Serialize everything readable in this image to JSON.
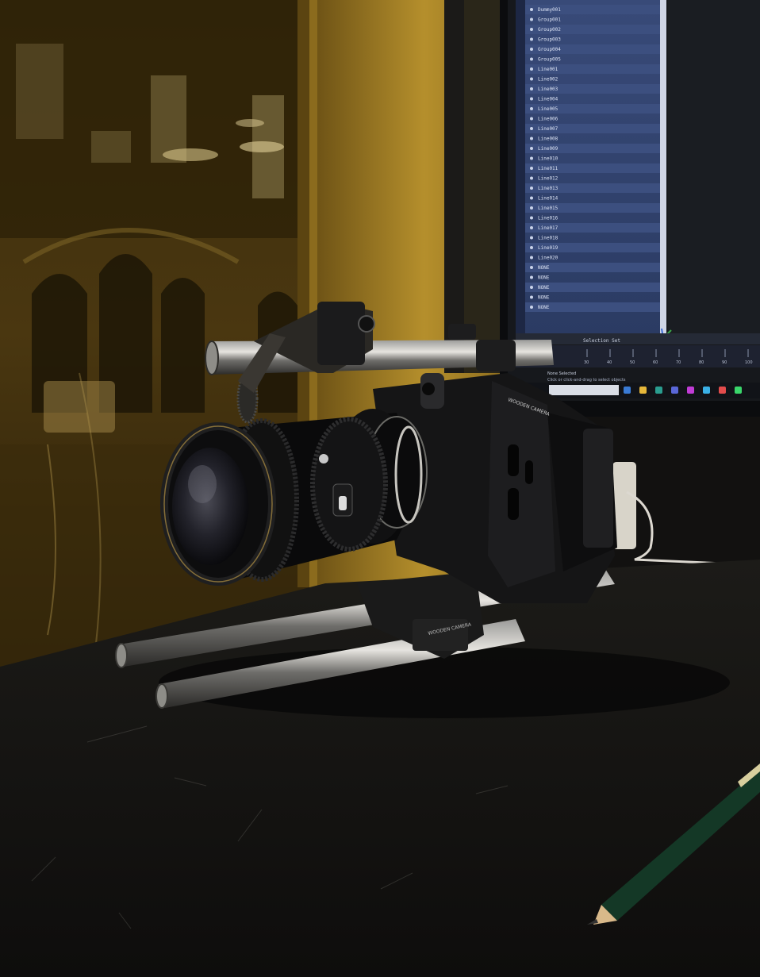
{
  "photo": {
    "description_hidden": false
  },
  "monitor": {
    "outliner_items": [
      "Dummy001",
      "Group001",
      "Group002",
      "Group003",
      "Group004",
      "Group005",
      "Line001",
      "Line002",
      "Line003",
      "Line004",
      "Line005",
      "Line006",
      "Line007",
      "Line008",
      "Line009",
      "Line010",
      "Line011",
      "Line012",
      "Line013",
      "Line014",
      "Line015",
      "Line016",
      "Line017",
      "Line018",
      "Line019",
      "Line020",
      "NONE",
      "NONE",
      "NONE",
      "NONE",
      "NONE"
    ],
    "selection_set_label": "Selection Set",
    "none_selected": "None Selected",
    "status_hint": "Click or click-and-drag to select objects",
    "timeline_ticks": [
      "30",
      "40",
      "50",
      "60",
      "70",
      "80",
      "90",
      "100"
    ]
  },
  "camera": {
    "cage_brand_top": "WOODEN CAMERA",
    "cage_brand_bottom": "WOODEN CAMERA"
  },
  "colors": {
    "window_glow": "#b08a2a",
    "desk": "#141311",
    "monitor_ui": "#2f3d63",
    "screen_dark": "#1a1d22"
  }
}
